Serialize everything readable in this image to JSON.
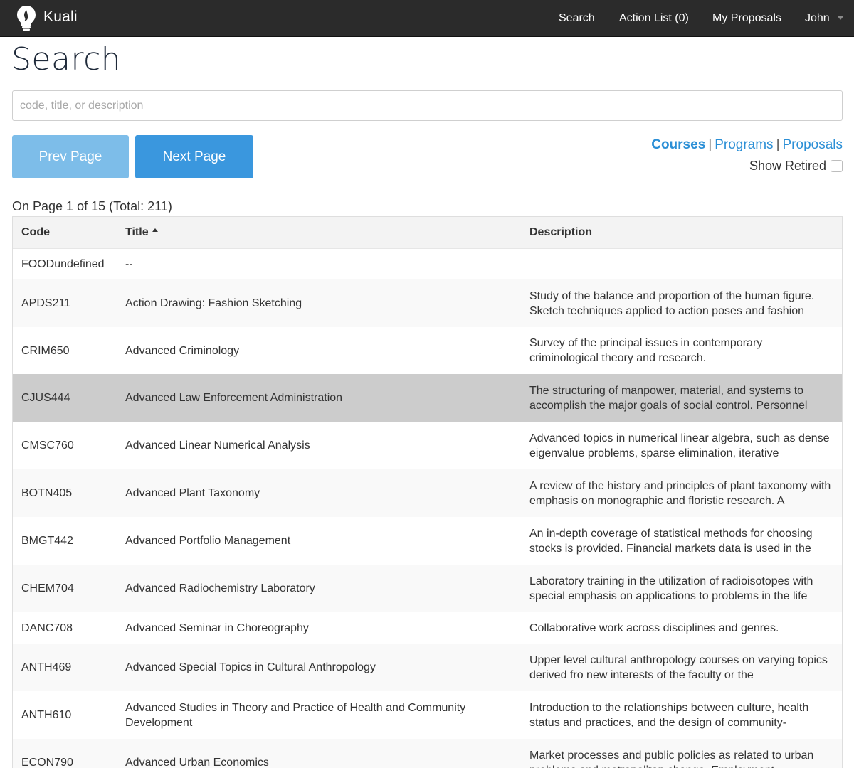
{
  "nav": {
    "brand": "Kuali",
    "search": "Search",
    "action_list": "Action List (0)",
    "my_proposals": "My Proposals",
    "user": "John"
  },
  "page": {
    "title": "Search",
    "search_placeholder": "code, title, or description",
    "search_value": ""
  },
  "paging": {
    "prev_label": "Prev Page",
    "next_label": "Next Page",
    "info": "On Page 1 of 15 (Total: 211)"
  },
  "filters": {
    "courses": "Courses",
    "programs": "Programs",
    "proposals": "Proposals",
    "separator": "|",
    "show_retired": "Show Retired",
    "show_retired_checked": false
  },
  "table": {
    "columns": {
      "code": "Code",
      "title": "Title",
      "description": "Description"
    },
    "sorted_by": "title",
    "sort_direction": "ascending",
    "rows": [
      {
        "code": "FOODundefined",
        "title": "--",
        "description": ""
      },
      {
        "code": "APDS211",
        "title": "Action Drawing: Fashion Sketching",
        "description": "Study of the balance and proportion of the human figure. Sketch techniques applied to action poses and fashion"
      },
      {
        "code": "CRIM650",
        "title": "Advanced Criminology",
        "description": "Survey of the principal issues in contemporary criminological theory and research."
      },
      {
        "code": "CJUS444",
        "title": "Advanced Law Enforcement Administration",
        "description": "The structuring of manpower, material, and systems to accomplish the major goals of social control. Personnel",
        "selected": true
      },
      {
        "code": "CMSC760",
        "title": "Advanced Linear Numerical Analysis",
        "description": "Advanced topics in numerical linear algebra, such as dense eigenvalue problems, sparse elimination, iterative"
      },
      {
        "code": "BOTN405",
        "title": "Advanced Plant Taxonomy",
        "description": "A review of the history and principles of plant taxonomy with emphasis on monographic and floristic research. A"
      },
      {
        "code": "BMGT442",
        "title": "Advanced Portfolio Management",
        "description": "An in-depth coverage of statistical methods for choosing stocks is provided. Financial markets data is used in the"
      },
      {
        "code": "CHEM704",
        "title": "Advanced Radiochemistry Laboratory",
        "description": "Laboratory training in the utilization of radioisotopes with special emphasis on applications to problems in the life"
      },
      {
        "code": "DANC708",
        "title": "Advanced Seminar in Choreography",
        "description": "Collaborative work across disciplines and genres."
      },
      {
        "code": "ANTH469",
        "title": "Advanced Special Topics in Cultural Anthropology",
        "description": "Upper level cultural anthropology courses on varying topics derived fro new interests of the faculty or the"
      },
      {
        "code": "ANTH610",
        "title": "Advanced Studies in Theory and Practice of Health and Community Development",
        "description": "Introduction to the relationships between culture, health status and practices, and the design of community-"
      },
      {
        "code": "ECON790",
        "title": "Advanced Urban Economics",
        "description": "Market processes and public policies as related to urban problems and metropolitan change. Employment"
      }
    ]
  },
  "colors": {
    "navbar_bg": "#2b2b2b",
    "link": "#2b8fd6",
    "btn_prev": "#7dbde9",
    "btn_next": "#3a97de",
    "selected_row": "#cccccc"
  },
  "icons": {
    "brand": "lightbulb-icon",
    "user_menu": "caret-down-icon",
    "sort": "sort-ascending-icon"
  }
}
